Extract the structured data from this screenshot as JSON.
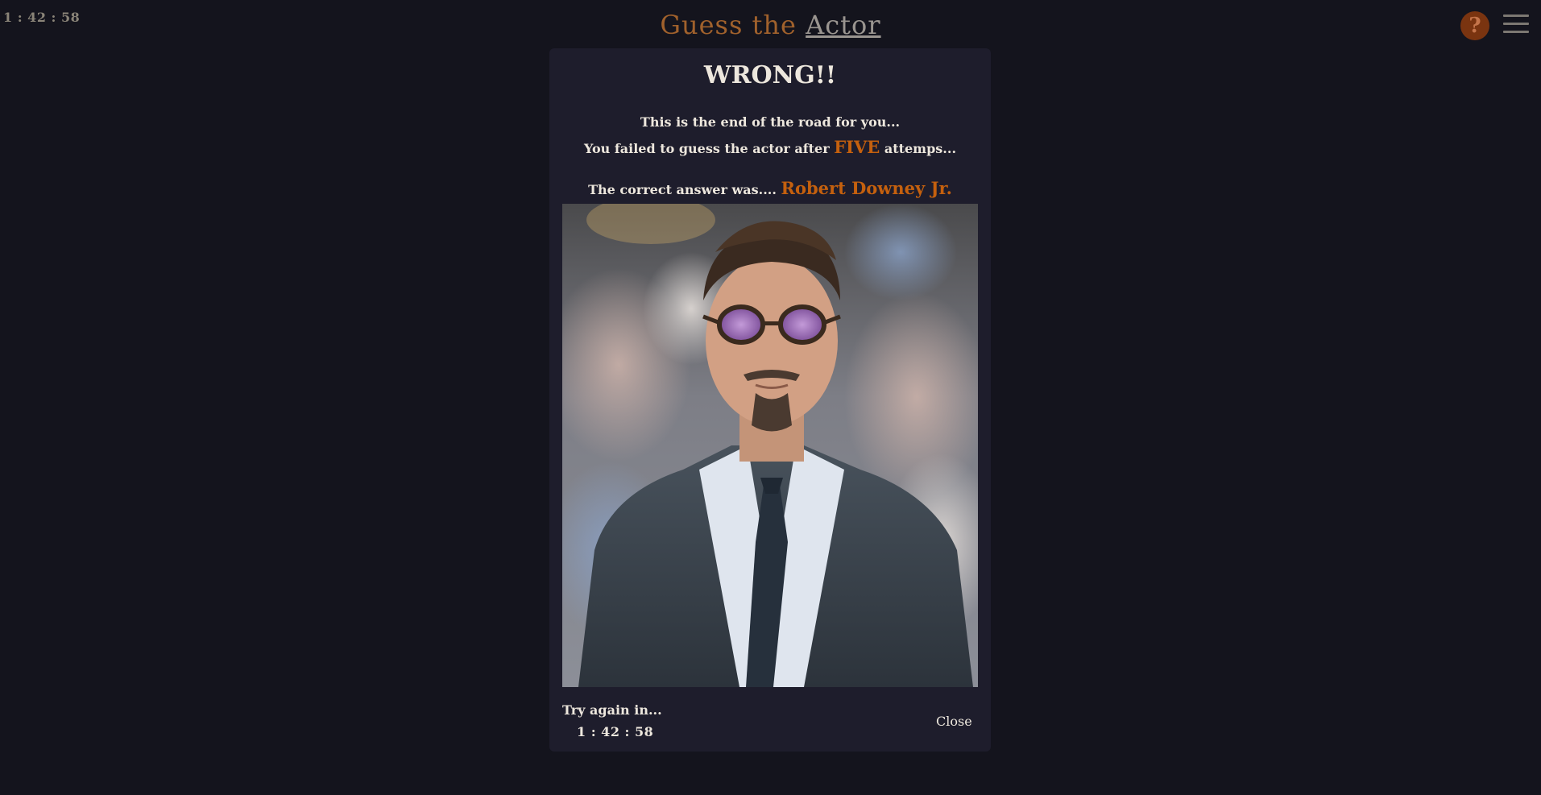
{
  "header": {
    "countdown": "1 : 42 : 58",
    "title_prefix": "Guess the",
    "title_link": "Actor",
    "help_symbol": "?",
    "help_icon": "question-mark-icon",
    "menu_icon": "hamburger-menu-icon"
  },
  "modal": {
    "heading": "WRONG!!",
    "line1": "This is the end of the road for you...",
    "line2_before": "You failed to guess the actor after",
    "line2_highlight": "FIVE",
    "line2_after": "attemps...",
    "line3_before": "The correct answer was....",
    "answer": "Robert Downey Jr.",
    "try_again_label": "Try again in...",
    "try_again_timer": "1 : 42 : 58",
    "close_label": "Close"
  },
  "colors": {
    "background": "#14141d",
    "modal": "#1e1d2c",
    "accent": "#c4600e",
    "help_button": "#7a3410"
  }
}
